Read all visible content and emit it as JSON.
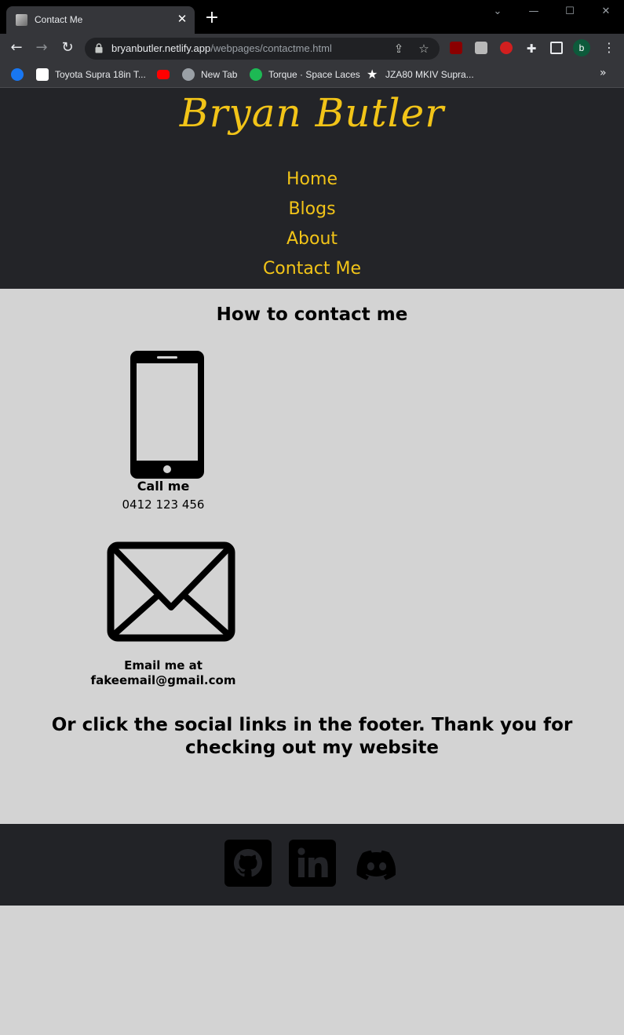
{
  "browser": {
    "tab_title": "Contact Me",
    "url_host": "bryanbutler.netlify.app",
    "url_path": "/webpages/contactme.html",
    "profile_initial": "b",
    "bookmarks": [
      {
        "label": "",
        "icon": "facebook-icon",
        "color": "#1877f2"
      },
      {
        "label": "Toyota Supra 18in T...",
        "icon": "toyota-bookmark-icon",
        "color": "#ffffff"
      },
      {
        "label": "",
        "icon": "youtube-icon",
        "color": "#ff0000"
      },
      {
        "label": "New Tab",
        "icon": "globe-icon",
        "color": "#9aa0a6"
      },
      {
        "label": "Torque · Space Laces",
        "icon": "spotify-icon",
        "color": "#1db954"
      },
      {
        "label": "JZA80 MKIV Supra...",
        "icon": "star-bookmark-icon",
        "color": "#ffffff"
      }
    ]
  },
  "site": {
    "logo": "Bryan Butler",
    "nav": [
      "Home",
      "Blogs",
      "About",
      "Contact Me"
    ],
    "accent_color": "#f2c418",
    "header_bg": "#232428",
    "body_bg": "#d3d3d3"
  },
  "contact": {
    "title": "How to contact me",
    "phone": {
      "label": "Call me",
      "number": "0412 123 456",
      "icon": "phone-icon"
    },
    "email": {
      "label": "Email me at",
      "address": "fakeemail@gmail.com",
      "icon": "mail-icon"
    },
    "closing": "Or click the social links in the footer. Thank you for checking out my website"
  },
  "footer": {
    "socials": [
      "github-icon",
      "linkedin-icon",
      "discord-icon"
    ]
  }
}
